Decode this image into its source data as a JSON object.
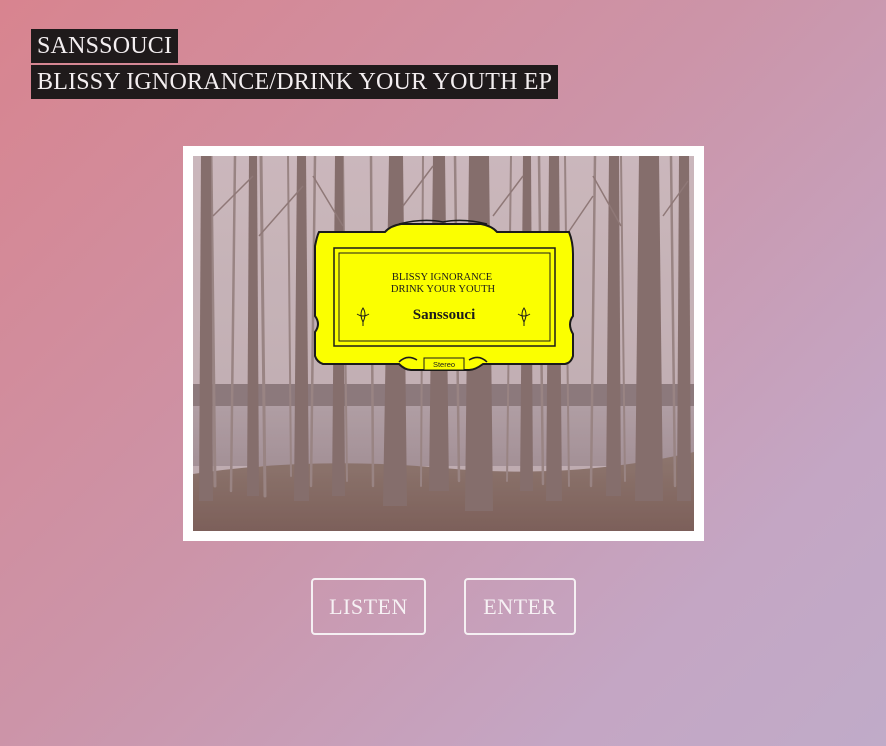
{
  "header": {
    "artist": "SANSSOUCI",
    "release": "BLISSY IGNORANCE/DRINK YOUR YOUTH EP"
  },
  "cover": {
    "label_line1": "BLISSY IGNORANCE",
    "label_line2": "DRINK YOUR YOUTH",
    "label_artist": "Sanssouci",
    "label_badge": "Stereo",
    "label_color": "#fbff00"
  },
  "actions": {
    "listen_label": "LISTEN",
    "enter_label": "ENTER"
  },
  "colors": {
    "title_bg": "#1f1a1b",
    "title_text": "#f3eef0",
    "gradient_start": "#d8848f",
    "gradient_end": "#c0abc8"
  }
}
